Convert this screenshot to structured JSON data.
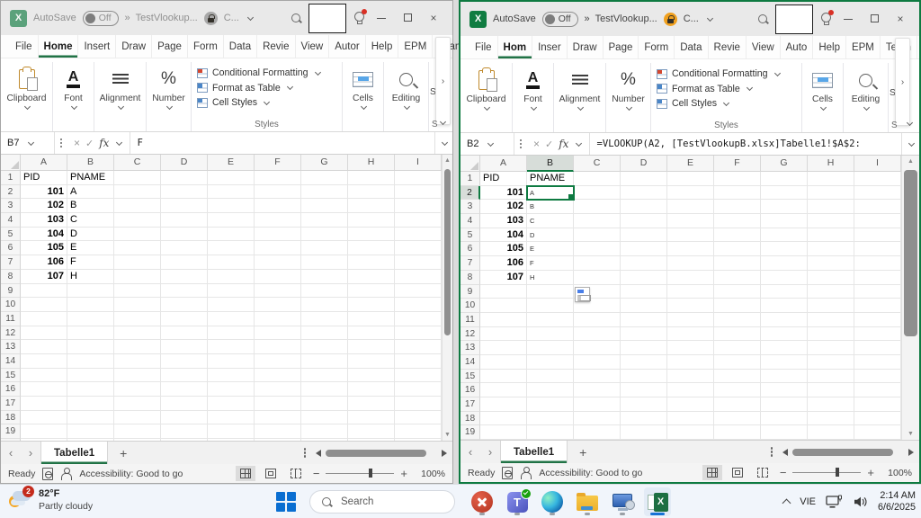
{
  "colors": {
    "excel_green": "#107c41",
    "active_window_border": "#0e7a41",
    "taskbar_accent": "#1572d6"
  },
  "shared": {
    "titlebar": {
      "autosave_label": "AutoSave",
      "autosave_state": "Off",
      "overflow_chevrons": "»",
      "filename": "TestVlookup...",
      "doc_label": "C..."
    },
    "ribbon": {
      "clipboard": "Clipboard",
      "font": "Font",
      "alignment": "Alignment",
      "number": "Number",
      "cells": "Cells",
      "editing": "Editing",
      "styles_label": "Styles",
      "conditional_formatting": "Conditional Formatting",
      "format_as_table": "Format as Table",
      "cell_styles": "Cell Styles",
      "truncated_group": "Se",
      "truncated_group_letter": "S"
    },
    "sheet_tab": "Tabelle1",
    "new_sheet_label": "+",
    "status": {
      "ready": "Ready",
      "accessibility": "Accessibility: Good to go",
      "zoom": "100%"
    }
  },
  "left_window": {
    "tabs": [
      "File",
      "Home",
      "Insert",
      "Draw",
      "Page",
      "Form",
      "Data",
      "Revie",
      "View",
      "Autor",
      "Help",
      "EPM",
      "Team"
    ],
    "active_tab_index": 1,
    "name_box": "B7",
    "formula": "F",
    "grid": {
      "col_headers": [
        "A",
        "B",
        "C",
        "D",
        "E",
        "F",
        "G",
        "H",
        "I"
      ],
      "rows": [
        [
          "PID",
          "PNAME"
        ],
        [
          "101",
          "A"
        ],
        [
          "102",
          "B"
        ],
        [
          "103",
          "C"
        ],
        [
          "104",
          "D"
        ],
        [
          "105",
          "E"
        ],
        [
          "106",
          "F"
        ],
        [
          "107",
          "H"
        ]
      ],
      "visible_row_count": 20
    }
  },
  "right_window": {
    "tabs": [
      "File",
      "Hom",
      "Inser",
      "Draw",
      "Page",
      "Form",
      "Data",
      "Revie",
      "View",
      "Auto",
      "Help",
      "EPM",
      "Team"
    ],
    "active_tab_index": 1,
    "name_box": "B2",
    "formula": "=VLOOKUP(A2, [TestVlookupB.xlsx]Tabelle1!$A$2:",
    "grid": {
      "col_headers": [
        "A",
        "B",
        "C",
        "D",
        "E",
        "F",
        "G",
        "H",
        "I"
      ],
      "rows": [
        [
          "PID",
          "PNAME"
        ],
        [
          "101",
          "A"
        ],
        [
          "102",
          "B"
        ],
        [
          "103",
          "C"
        ],
        [
          "104",
          "D"
        ],
        [
          "105",
          "E"
        ],
        [
          "106",
          "F"
        ],
        [
          "107",
          "H"
        ]
      ],
      "selected_cell": {
        "row": 2,
        "col": 1
      },
      "small_font_col": 1,
      "visible_row_count": 20
    }
  },
  "taskbar": {
    "weather": {
      "temp": "82°F",
      "condition": "Partly cloudy",
      "badge": "2"
    },
    "search_placeholder": "Search",
    "apps": [
      "red-x-app",
      "teams",
      "edge",
      "file-explorer",
      "remote-pc",
      "excel"
    ],
    "tray": {
      "language": "VIE",
      "time": "2:14 AM",
      "date": "6/6/2025"
    }
  }
}
